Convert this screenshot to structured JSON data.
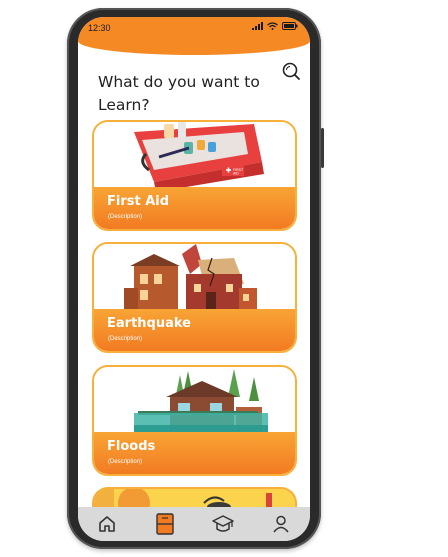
{
  "status_bar": {
    "time": "12:30"
  },
  "main": {
    "title": "What do you want to Learn?"
  },
  "topics": [
    {
      "name": "First Aid",
      "description": "(Description)"
    },
    {
      "name": "Earthquake",
      "description": "(Description)"
    },
    {
      "name": "Floods",
      "description": "(Description)"
    }
  ],
  "bottom_nav": [
    "home-icon",
    "book-icon",
    "graduation-cap-icon",
    "profile-icon"
  ],
  "colors": {
    "accent": "#f58a25",
    "card_border": "#f8b03b",
    "nav_bg": "#d9d9d9"
  }
}
